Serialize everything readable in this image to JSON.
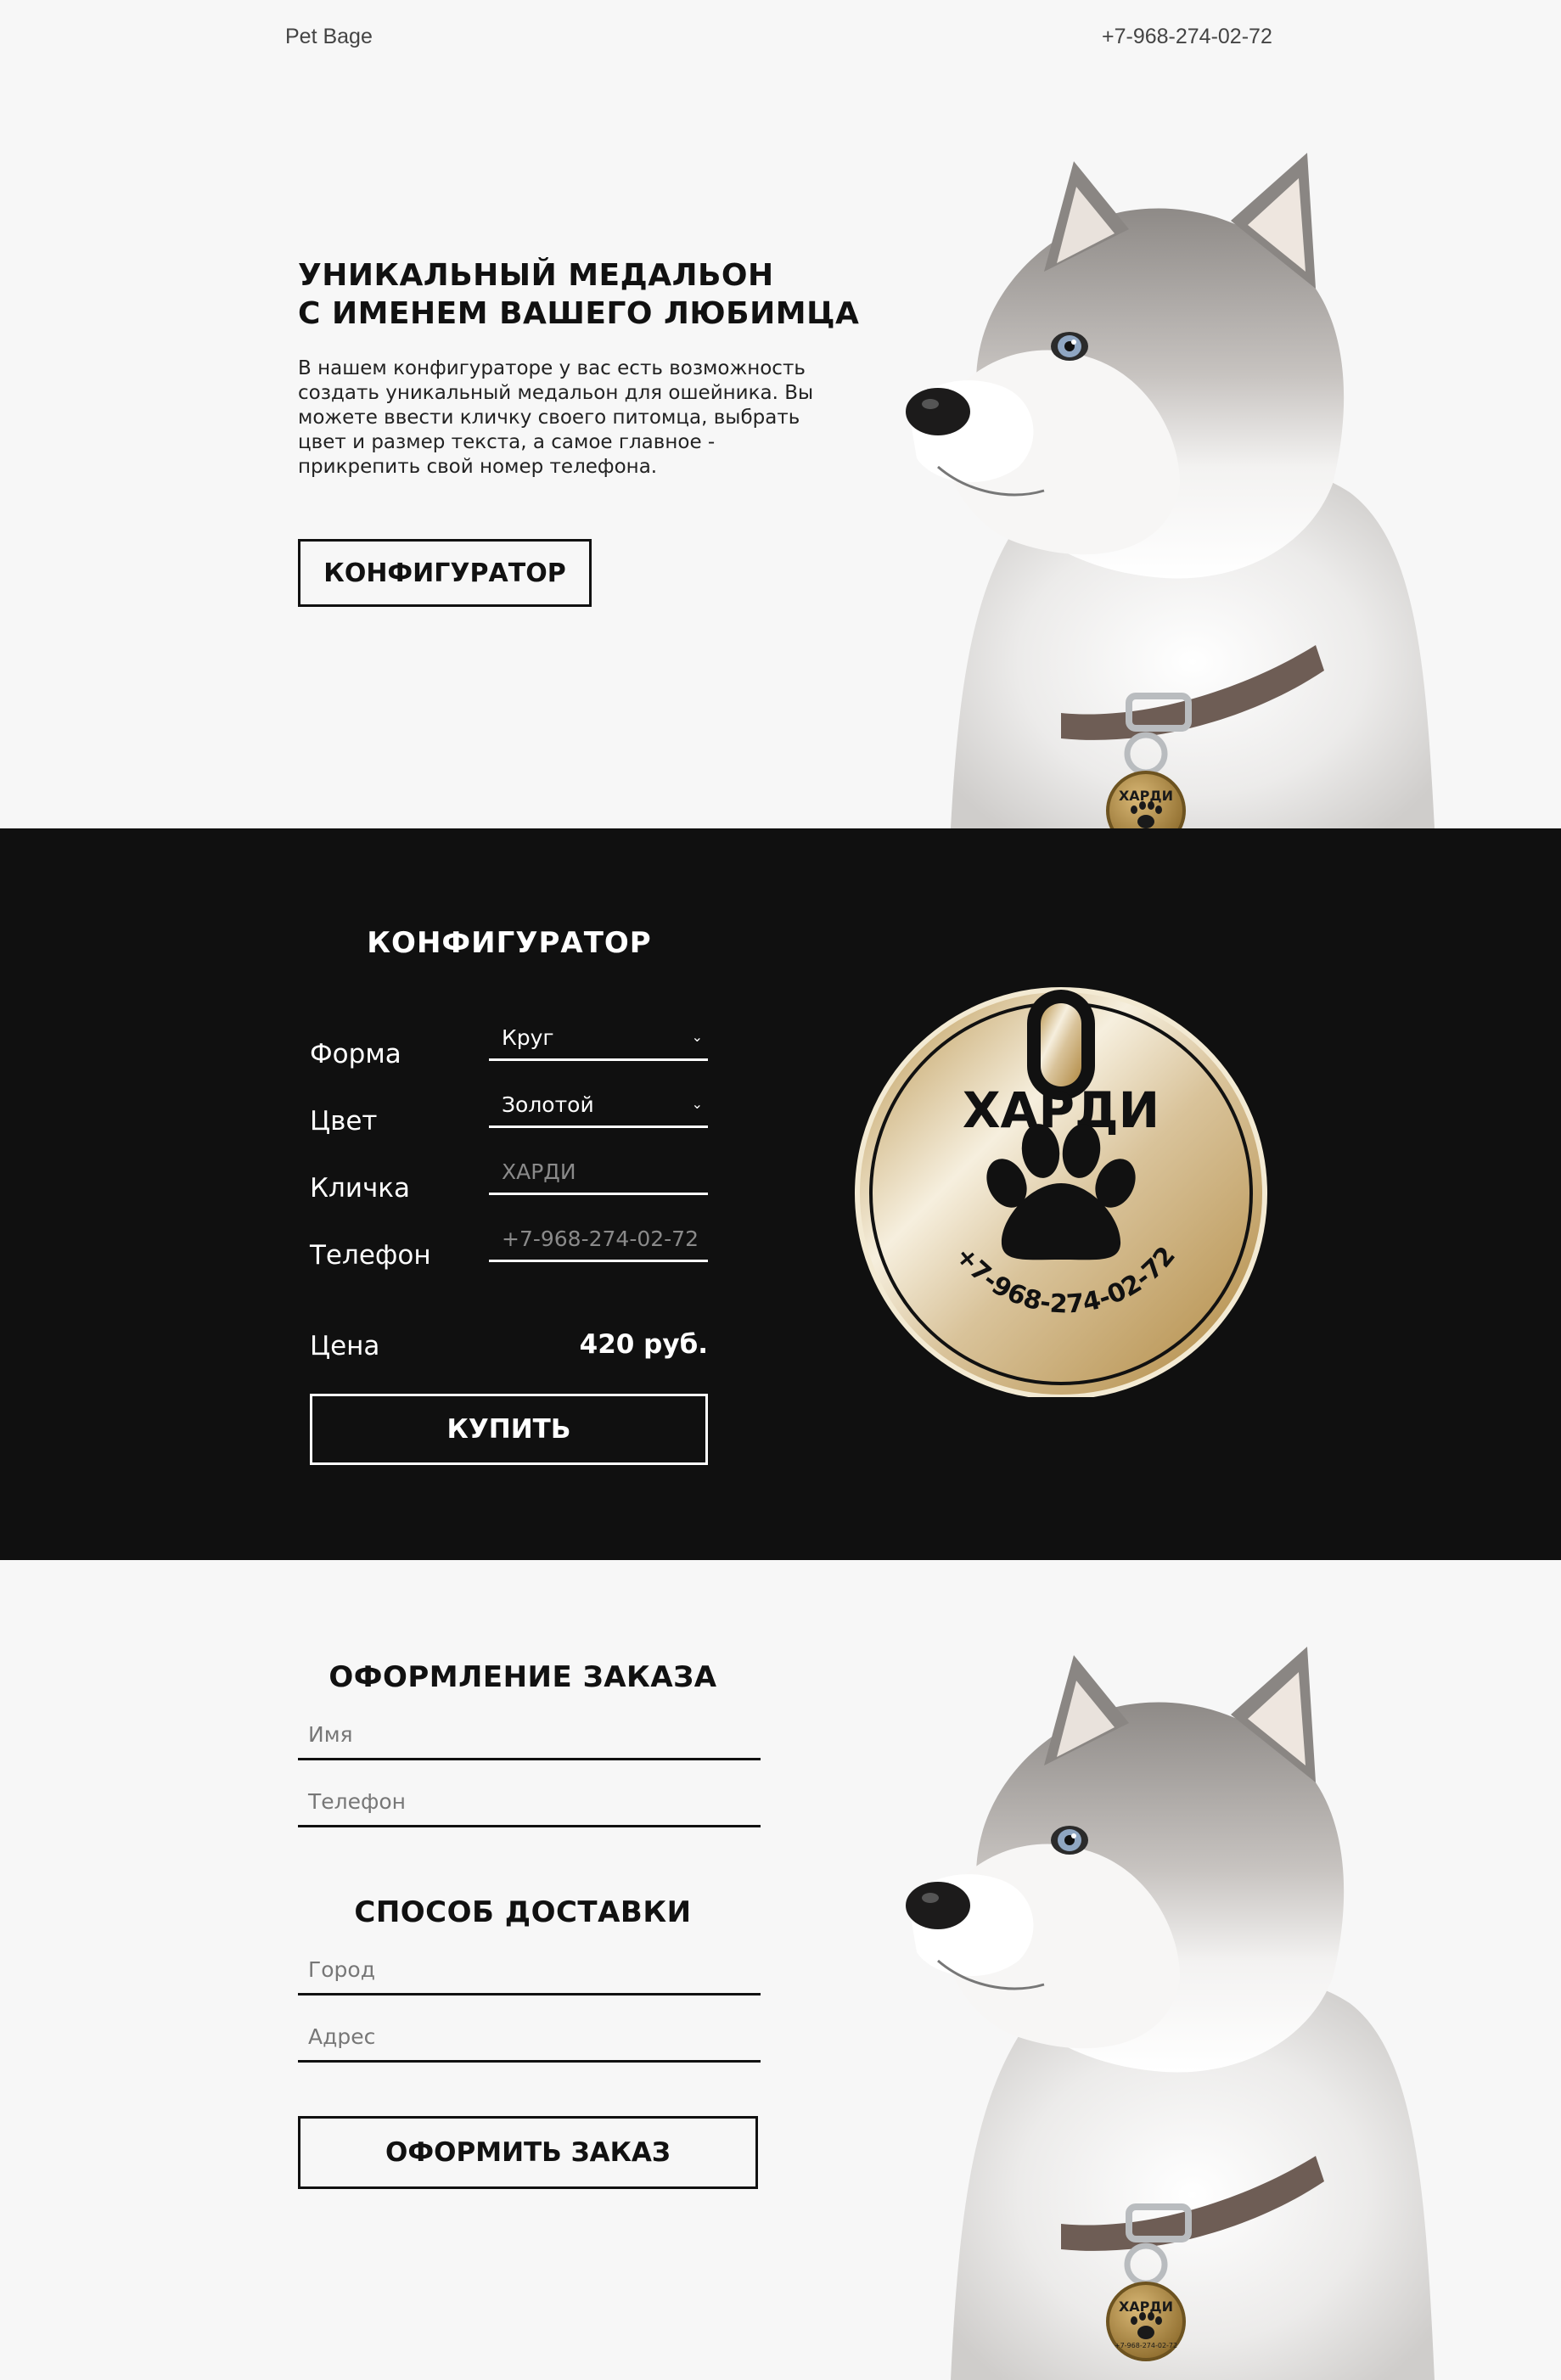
{
  "header": {
    "brand": "Pet Bage",
    "phone": "+7-968-274-02-72"
  },
  "hero": {
    "title_line1": "УНИКАЛЬНЫЙ МЕДАЛЬОН",
    "title_line2": "С ИМЕНЕМ ВАШЕГО ЛЮБИМЦА",
    "text": "В нашем конфигураторе у вас есть возможность создать уникальный медальон для ошейника. Вы можете ввести кличку своего питомца, выбрать цвет и размер текста, а самое главное - прикрепить свой номер телефона.",
    "button": "КОНФИГУРАТОР",
    "tag_name": "ХАРДИ",
    "tag_phone": "+7-968-274-02-72"
  },
  "configurator": {
    "title": "КОНФИГУРАТОР",
    "shape_label": "Форма",
    "shape_value": "Круг",
    "color_label": "Цвет",
    "color_value": "Золотой",
    "name_label": "Кличка",
    "name_placeholder": "ХАРДИ",
    "phone_label": "Телефон",
    "phone_placeholder": "+7-968-274-02-72",
    "price_label": "Цена",
    "price_value": "420 руб.",
    "buy_button": "КУПИТЬ",
    "caret": "⌄"
  },
  "medal": {
    "name": "ХАРДИ",
    "phone": "+7-968-274-02-72",
    "color_light": "#f4ead2",
    "color_dark": "#b89450"
  },
  "order": {
    "title": "ОФОРМЛЕНИЕ ЗАКАЗА",
    "name_placeholder": "Имя",
    "phone_placeholder": "Телефон",
    "delivery_title": "СПОСОБ ДОСТАВКИ",
    "city_placeholder": "Город",
    "address_placeholder": "Адрес",
    "submit_button": "ОФОРМИТЬ ЗАКАЗ"
  },
  "icons": {
    "hero_image": "husky-dog-image",
    "medal_icon": "paw-icon",
    "select_caret": "chevron-down-icon"
  }
}
